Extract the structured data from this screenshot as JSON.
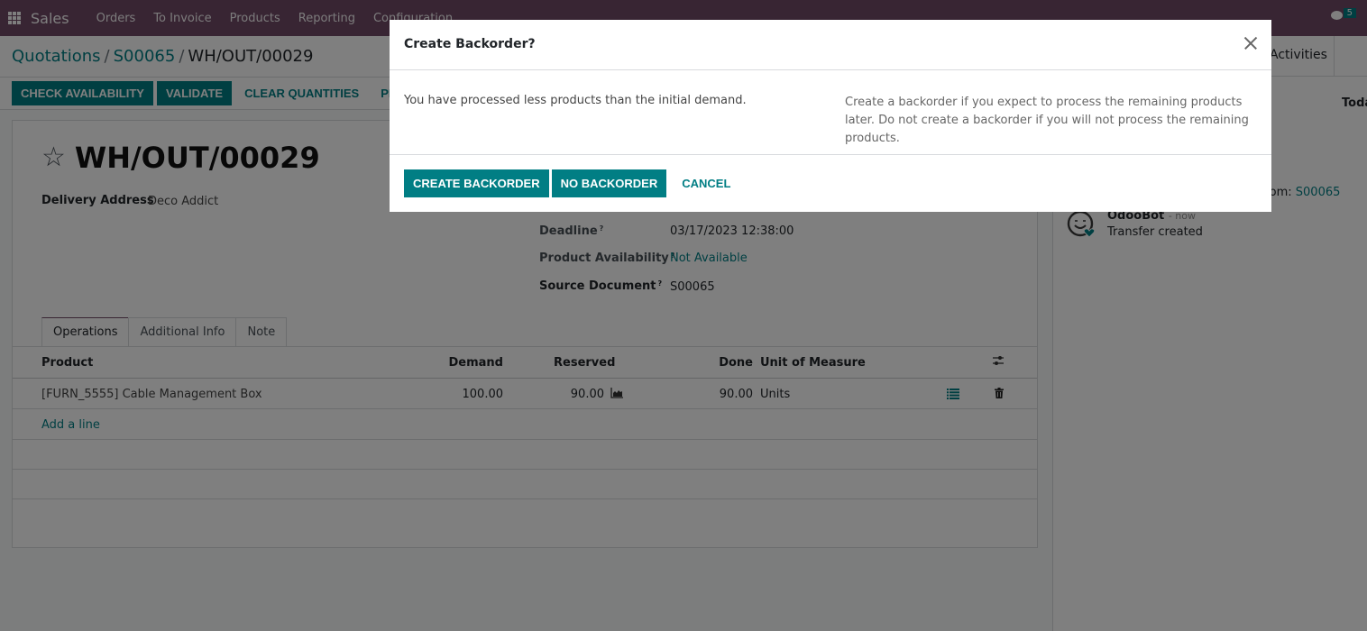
{
  "navbar": {
    "app_name": "Sales",
    "menu": [
      "Orders",
      "To Invoice",
      "Products",
      "Reporting",
      "Configuration"
    ],
    "chat_badge": "5"
  },
  "breadcrumb": {
    "items": [
      "Quotations",
      "S00065"
    ],
    "current": "WH/OUT/00029"
  },
  "actions": {
    "check_availability": "CHECK AVAILABILITY",
    "validate": "VALIDATE",
    "clear_quantities": "CLEAR QUANTITIES",
    "print": "PRINT"
  },
  "record": {
    "title": "WH/OUT/00029",
    "delivery_address_label": "Delivery Address",
    "delivery_address": "Deco Addict",
    "deadline_label": "Deadline",
    "deadline": "03/17/2023 12:38:00",
    "availability_label": "Product Availability",
    "availability": "Not Available",
    "source_label": "Source Document",
    "source": "S00065",
    "help_mark": "?"
  },
  "tabs": [
    "Operations",
    "Additional Info",
    "Note"
  ],
  "table": {
    "headers": {
      "product": "Product",
      "demand": "Demand",
      "reserved": "Reserved",
      "done": "Done",
      "uom": "Unit of Measure"
    },
    "rows": [
      {
        "product": "[FURN_5555] Cable Management Box",
        "demand": "100.00",
        "reserved": "90.00",
        "done": "90.00",
        "uom": "Units"
      }
    ],
    "add_line": "Add a line"
  },
  "chatter": {
    "activities": "Activities",
    "today": "Today",
    "from_label": "from:",
    "from_link": "S00065",
    "message": {
      "author": "OdooBot",
      "time": "- now",
      "text": "Transfer created"
    }
  },
  "modal": {
    "title": "Create Backorder?",
    "message": "You have processed less products than the initial demand.",
    "help": "Create a backorder if you expect to process the remaining products later. Do not create a backorder if you will not process the remaining products.",
    "create_backorder": "CREATE BACKORDER",
    "no_backorder": "NO BACKORDER",
    "cancel": "CANCEL"
  },
  "colors": {
    "brand": "#714b67",
    "accent": "#017e84"
  }
}
